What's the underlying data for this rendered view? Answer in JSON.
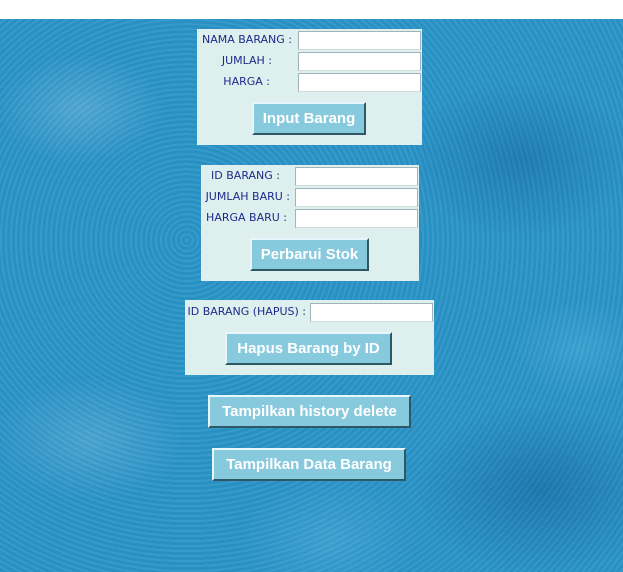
{
  "input_form": {
    "nama_label": "NAMA BARANG :",
    "jumlah_label": "JUMLAH :",
    "harga_label": "HARGA :",
    "nama_value": "",
    "jumlah_value": "",
    "harga_value": "",
    "submit_label": "Input Barang"
  },
  "update_form": {
    "id_label": "ID BARANG :",
    "jumlah_baru_label": "JUMLAH BARU :",
    "harga_baru_label": "HARGA BARU :",
    "id_value": "",
    "jumlah_baru_value": "",
    "harga_baru_value": "",
    "submit_label": "Perbarui Stok"
  },
  "delete_form": {
    "id_label": "ID BARANG (HAPUS) :",
    "id_value": "",
    "submit_label": "Hapus Barang by ID"
  },
  "actions": {
    "history_label": "Tampilkan history delete",
    "data_label": "Tampilkan Data Barang"
  },
  "colors": {
    "background": "#2b95c8",
    "panel": "#ddf0ee",
    "label_text": "#1e2a8a",
    "button": "#87c9dd",
    "button_text": "#ffffff"
  }
}
